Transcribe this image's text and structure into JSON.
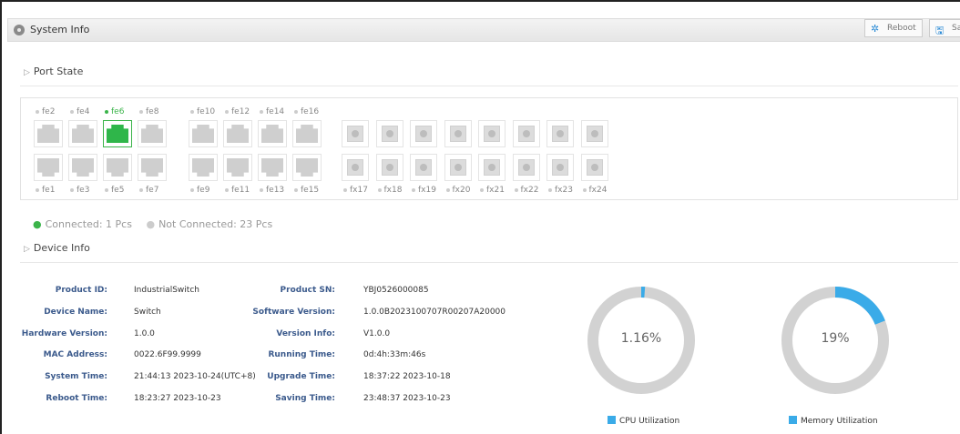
{
  "header": {
    "title": "System Info",
    "reboot_label": "Reboot",
    "save_label": "Sav"
  },
  "port_state": {
    "heading": "Port State",
    "top_labels": [
      {
        "label": "fe2",
        "connected": false
      },
      {
        "label": "fe4",
        "connected": false
      },
      {
        "label": "fe6",
        "connected": true
      },
      {
        "label": "fe8",
        "connected": false
      },
      {
        "label": "fe10",
        "connected": false
      },
      {
        "label": "fe12",
        "connected": false
      },
      {
        "label": "fe14",
        "connected": false
      },
      {
        "label": "fe16",
        "connected": false
      }
    ],
    "bottom_labels": [
      {
        "label": "fe1",
        "connected": false
      },
      {
        "label": "fe3",
        "connected": false
      },
      {
        "label": "fe5",
        "connected": false
      },
      {
        "label": "fe7",
        "connected": false
      },
      {
        "label": "fe9",
        "connected": false
      },
      {
        "label": "fe11",
        "connected": false
      },
      {
        "label": "fe13",
        "connected": false
      },
      {
        "label": "fe15",
        "connected": false
      }
    ],
    "fiber_labels": [
      "fx17",
      "fx18",
      "fx19",
      "fx20",
      "fx21",
      "fx22",
      "fx23",
      "fx24"
    ],
    "legend_connected": "Connected: 1 Pcs",
    "legend_not_connected": "Not Connected: 23 Pcs"
  },
  "device_info": {
    "heading": "Device Info",
    "left": [
      {
        "label": "Product ID:",
        "value": "IndustrialSwitch"
      },
      {
        "label": "Device Name:",
        "value": "Switch"
      },
      {
        "label": "Hardware Version:",
        "value": "1.0.0"
      },
      {
        "label": "MAC Address:",
        "value": "0022.6F99.9999"
      },
      {
        "label": "System Time:",
        "value": "21:44:13 2023-10-24(UTC+8)"
      },
      {
        "label": "Reboot Time:",
        "value": "18:23:27 2023-10-23"
      }
    ],
    "right": [
      {
        "label": "Product SN:",
        "value": "YBJ0526000085"
      },
      {
        "label": "Software Version:",
        "value": "1.0.0B2023100707R00207A20000"
      },
      {
        "label": "Version Info:",
        "value": "V1.0.0"
      },
      {
        "label": "Running Time:",
        "value": "0d:4h:33m:46s"
      },
      {
        "label": "Upgrade Time:",
        "value": "18:37:22 2023-10-18"
      },
      {
        "label": "Saving Time:",
        "value": "23:48:37 2023-10-23"
      }
    ]
  },
  "utilization": {
    "cpu": {
      "text": "1.16%",
      "fraction": 0.0116,
      "legend": "CPU Utilization"
    },
    "memory": {
      "text": "19%",
      "fraction": 0.19,
      "legend": "Memory Utilization"
    }
  },
  "colors": {
    "connected": "#3bb44a",
    "ring_fill": "#3aabe8",
    "ring_track": "#d2d2d2",
    "label_blue": "#3b5a8c"
  }
}
